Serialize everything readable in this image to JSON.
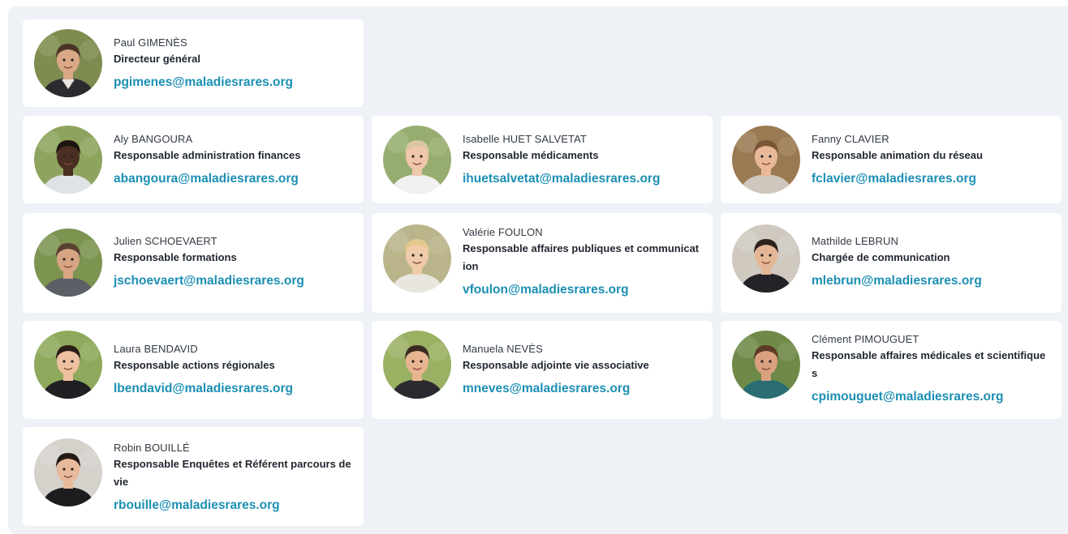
{
  "staff": [
    {
      "name": "Paul GIMENÈS",
      "role": "Directeur général",
      "email": "pgimenes@maladiesrares.org",
      "avatar": {
        "bg": "#7e8c4f",
        "skin": "#d9a887",
        "hair": "#4a3426",
        "shirt": "#e9e6e1",
        "jacket": "#2c2b2f"
      }
    },
    {
      "name": "Aly BANGOURA",
      "role": "Responsable administration finances",
      "email": "abangoura@maladiesrares.org",
      "avatar": {
        "bg": "#8ea45e",
        "skin": "#4a2f22",
        "hair": "#1c1410",
        "shirt": "#dfe3e8",
        "jacket": "#dfe3e8"
      }
    },
    {
      "name": "Isabelle HUET SALVETAT",
      "role": "Responsable médicaments",
      "email": "ihuetsalvetat@maladiesrares.org",
      "avatar": {
        "bg": "#97ad6f",
        "skin": "#eec7ac",
        "hair": "#d8c7a2",
        "shirt": "#f1f1f1",
        "jacket": "#f1f1f1"
      }
    },
    {
      "name": "Fanny CLAVIER",
      "role": "Responsable animation du réseau",
      "email": "fclavier@maladiesrares.org",
      "avatar": {
        "bg": "#9a7a52",
        "skin": "#e8b898",
        "hair": "#7b5538",
        "shirt": "#cfc7bd",
        "jacket": "#cfc7bd"
      }
    },
    {
      "name": "Julien SCHOEVAERT",
      "role": "Responsable formations",
      "email": "jschoevaert@maladiesrares.org",
      "avatar": {
        "bg": "#7c9450",
        "skin": "#d6a584",
        "hair": "#5a4030",
        "shirt": "#5b5f66",
        "jacket": "#5b5f66"
      }
    },
    {
      "name": "Valérie FOULON",
      "role": "Responsable affaires publiques et communication",
      "email": "vfoulon@maladiesrares.org",
      "avatar": {
        "bg": "#b9b48a",
        "skin": "#f0cba9",
        "hair": "#e3c98f",
        "shirt": "#e9e6df",
        "jacket": "#e9e6df"
      }
    },
    {
      "name": "Mathilde LEBRUN",
      "role": "Chargée de communication",
      "email": "mlebrun@maladiesrares.org",
      "avatar": {
        "bg": "#cfc9c0",
        "skin": "#e3b696",
        "hair": "#2e221c",
        "shirt": "#232226",
        "jacket": "#232226"
      }
    },
    {
      "name": "Laura BENDAVID",
      "role": "Responsable actions régionales",
      "email": "lbendavid@maladiesrares.org",
      "avatar": {
        "bg": "#8fa95c",
        "skin": "#eec0a0",
        "hair": "#2a1d18",
        "shirt": "#1f1f24",
        "jacket": "#1f1f24"
      }
    },
    {
      "name": "Manuela NEVÈS",
      "role": "Responsable adjointe vie associative",
      "email": "mneves@maladiesrares.org",
      "avatar": {
        "bg": "#9ab063",
        "skin": "#e7b590",
        "hair": "#3c2a22",
        "shirt": "#2c2a30",
        "jacket": "#2c2a30"
      }
    },
    {
      "name": "Clément PIMOUGUET",
      "role": "Responsable affaires médicales et scientifiques",
      "email": "cpimouguet@maladiesrares.org",
      "avatar": {
        "bg": "#6f8a48",
        "skin": "#d9a17f",
        "hair": "#5e3b27",
        "shirt": "#2a6e73",
        "jacket": "#2a6e73"
      }
    },
    {
      "name": "Robin BOUILLÉ",
      "role": "Responsable Enquêtes et Référent parcours de vie",
      "email": "rbouille@maladiesrares.org",
      "avatar": {
        "bg": "#d5d1cb",
        "skin": "#e8b99b",
        "hair": "#241a16",
        "shirt": "#1d1d20",
        "jacket": "#1d1d20"
      }
    }
  ]
}
